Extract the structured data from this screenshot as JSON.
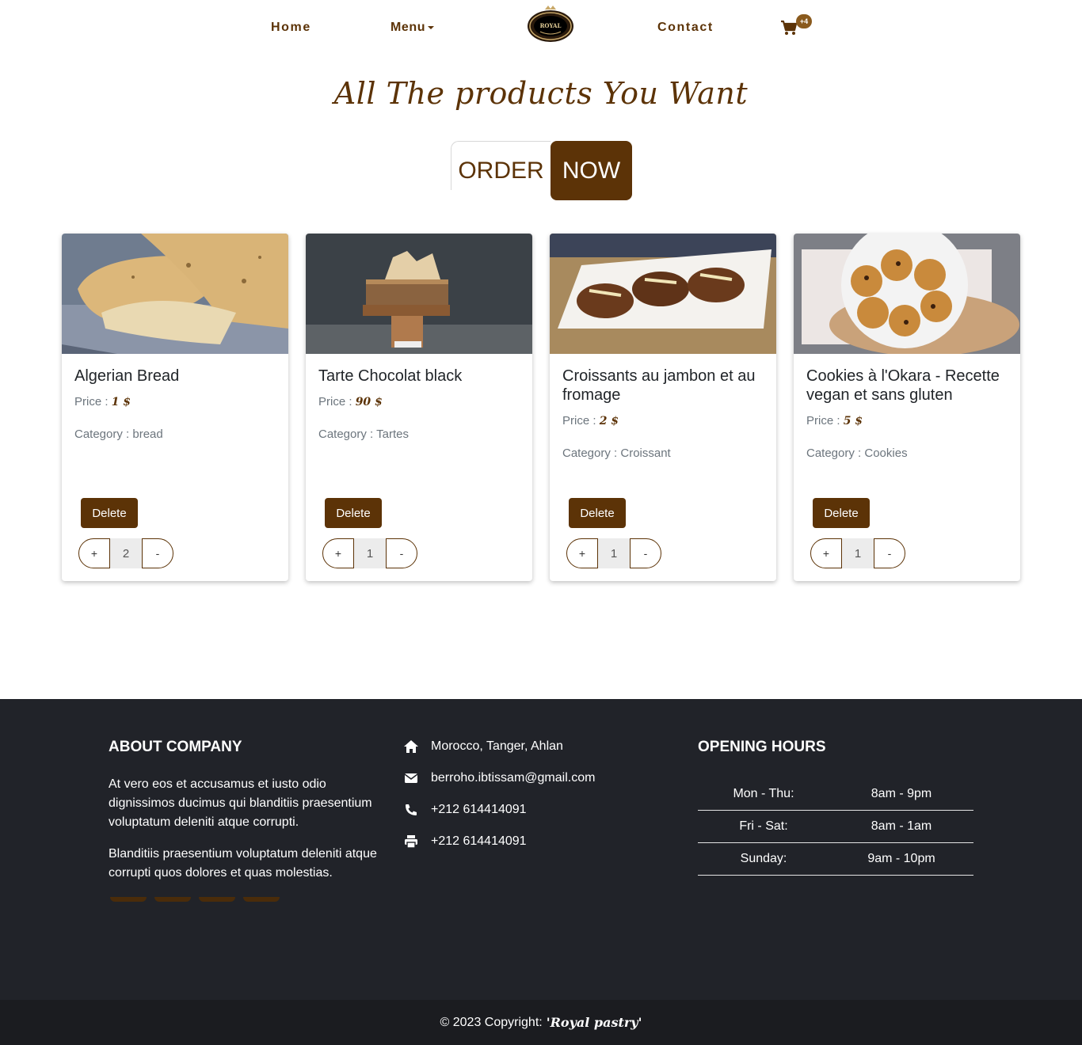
{
  "nav": {
    "home": "Home",
    "menu": "Menu",
    "contact": "Contact",
    "logo_text": "ROYAL",
    "cart_badge": "+4"
  },
  "hero": {
    "title": "All The products You Want",
    "order": "ORDER",
    "now": "NOW"
  },
  "labels": {
    "price": "Price : ",
    "category": "Category : ",
    "delete": "Delete",
    "plus": "+",
    "minus": "-"
  },
  "products": [
    {
      "name": "Algerian Bread",
      "price": "1 $",
      "category": "bread",
      "qty": "2"
    },
    {
      "name": "Tarte Chocolat black",
      "price": "90 $",
      "category": "Tartes",
      "qty": "1"
    },
    {
      "name": "Croissants au jambon et au fromage",
      "price": "2 $",
      "category": "Croissant",
      "qty": "1"
    },
    {
      "name": "Cookies à l'Okara - Recette vegan et sans gluten",
      "price": "5 $",
      "category": "Cookies",
      "qty": "1"
    }
  ],
  "footer": {
    "about_title": "ABOUT COMPANY",
    "about_p1": "At vero eos et accusamus et iusto odio dignissimos ducimus qui blanditiis praesentium voluptatum deleniti atque corrupti.",
    "about_p2": "Blanditiis praesentium voluptatum deleniti atque corrupti quos dolores et quas molestias.",
    "address": "Morocco, Tanger, Ahlan",
    "email": "berroho.ibtissam@gmail.com",
    "phone": "+212 614414091",
    "fax": "+212 614414091",
    "hours_title": "OPENING HOURS",
    "hours": [
      {
        "day": "Mon - Thu:",
        "time": "8am - 9pm"
      },
      {
        "day": "Fri - Sat:",
        "time": "8am - 1am"
      },
      {
        "day": "Sunday:",
        "time": "9am - 10pm"
      }
    ],
    "copyright": "© 2023 Copyright:",
    "brand": "'Royal pastry'"
  },
  "colors": {
    "brand_brown": "#5c3307",
    "footer_bg": "#212329",
    "bottom_bg": "#1b1c20"
  }
}
